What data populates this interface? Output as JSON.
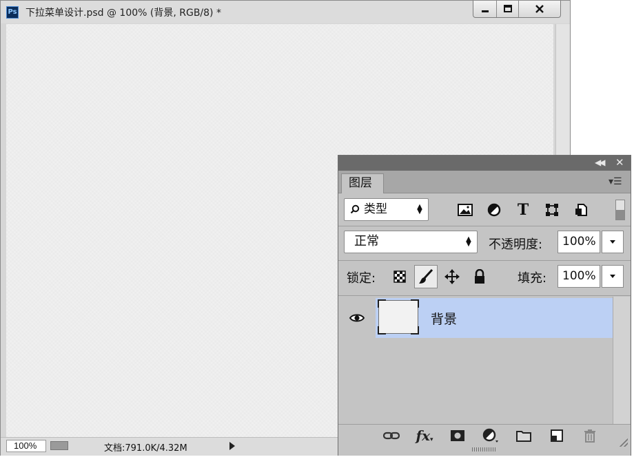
{
  "document": {
    "app_badge": "Ps",
    "title": "下拉菜单设计.psd @ 100% (背景, RGB/8) *",
    "window_buttons": [
      "minimize-icon",
      "maximize-icon",
      "close-icon"
    ],
    "canvas_color": "#f0f0f0",
    "status": {
      "zoom": "100%",
      "doc_info": "文档:791.0K/4.32M"
    }
  },
  "layers_panel": {
    "tab_label": "图层",
    "filter": {
      "label": "类型",
      "icons": [
        "image-filter-icon",
        "adjustment-filter-icon",
        "type-filter-icon",
        "shape-filter-icon",
        "smart-object-filter-icon"
      ],
      "type_glyph": "T"
    },
    "blend_mode": "正常",
    "opacity_label": "不透明度:",
    "opacity_value": "100%",
    "lock_label": "锁定:",
    "fill_label": "填充:",
    "fill_value": "100%",
    "layers": [
      {
        "name": "背景",
        "visible": true,
        "selected": true
      }
    ],
    "footer_buttons": [
      "link-layers-icon",
      "fx-icon",
      "add-mask-icon",
      "adjustment-layer-icon",
      "new-group-icon",
      "new-layer-icon",
      "delete-icon"
    ],
    "fx_label": "fx",
    "selection_color": "#bcd0f4"
  }
}
